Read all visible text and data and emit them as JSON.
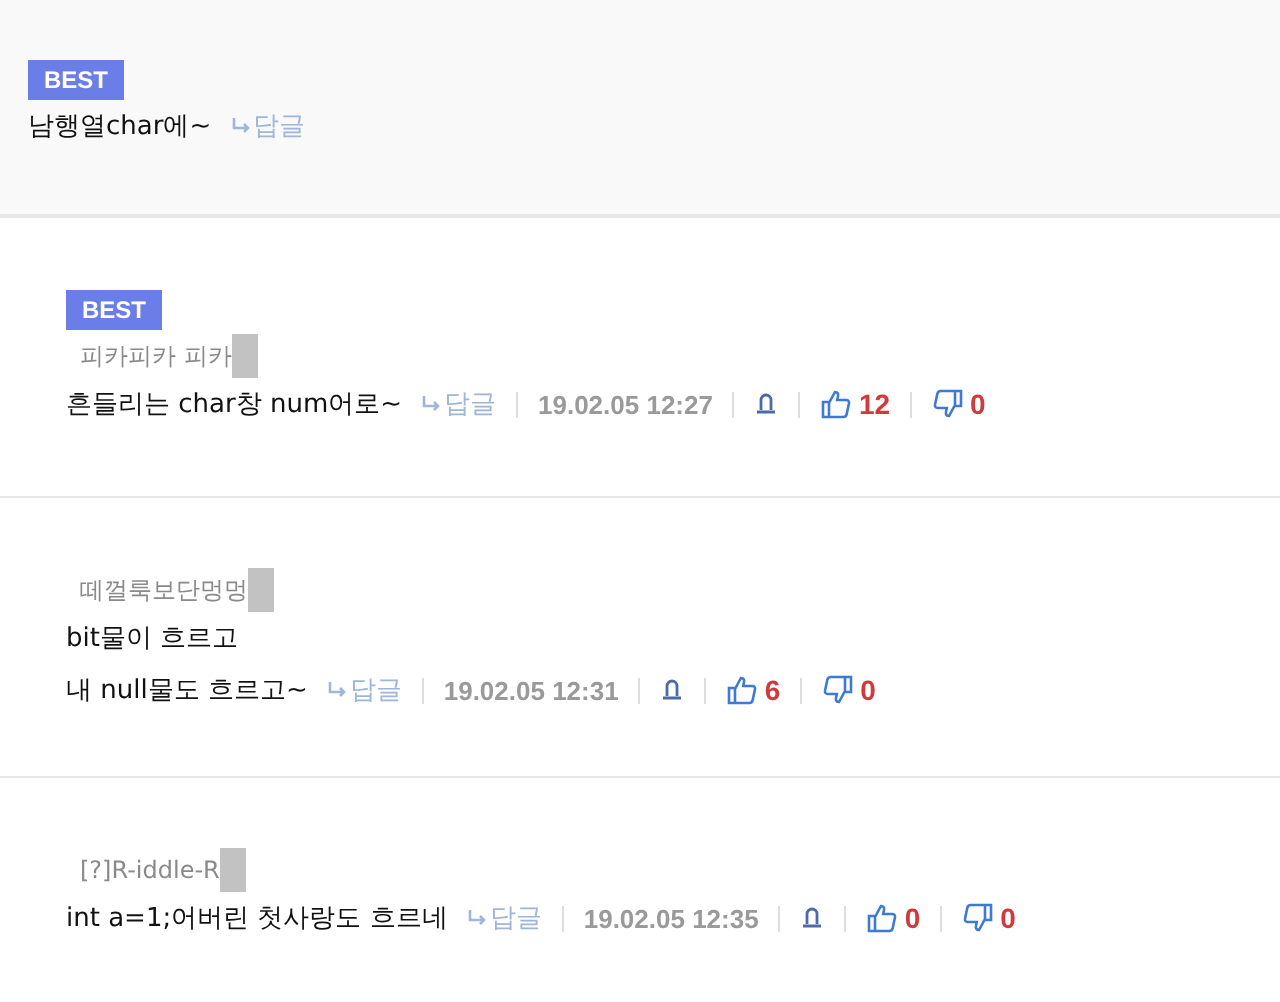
{
  "best_reply": {
    "badge": "BEST",
    "text": "남행열char에~",
    "reply_label": "답글"
  },
  "comments": [
    {
      "badge": "BEST",
      "author": "피카피카 피카",
      "redacted": true,
      "lines": [
        "흔들리는 char창 num어로~"
      ],
      "reply_label": "답글",
      "date": "19.02.05 12:27",
      "likes": "12",
      "dislikes": "0"
    },
    {
      "author": "떼껄룩보단멍멍",
      "redacted": true,
      "lines": [
        "bit물이 흐르고",
        "내 null물도 흐르고~"
      ],
      "reply_label": "답글",
      "date": "19.02.05 12:31",
      "likes": "6",
      "dislikes": "0"
    },
    {
      "author": "[?]R-iddle-R",
      "redacted": true,
      "lines": [
        "int a=1;어버린 첫사랑도 흐르네"
      ],
      "reply_label": "답글",
      "date": "19.02.05 12:35",
      "likes": "0",
      "dislikes": "0"
    }
  ]
}
